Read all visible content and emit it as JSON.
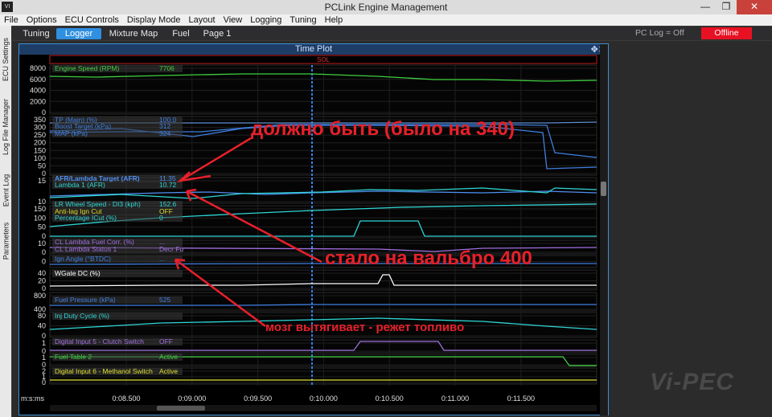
{
  "window": {
    "title": "PCLink Engine Management",
    "app_icon": "VI",
    "buttons": [
      "minimize-icon",
      "restore-icon",
      "close-icon"
    ]
  },
  "menu": [
    "File",
    "Options",
    "ECU Controls",
    "Display Mode",
    "Layout",
    "View",
    "Logging",
    "Tuning",
    "Help"
  ],
  "tabs": [
    {
      "label": "Tuning",
      "active": false
    },
    {
      "label": "Logger",
      "active": true
    },
    {
      "label": "Mixture Map",
      "active": false
    },
    {
      "label": "Fuel",
      "active": false
    },
    {
      "label": "Page 1",
      "active": false
    }
  ],
  "status": {
    "pclog": "PC Log = Off",
    "connection": "Offline"
  },
  "sidebar_tabs": [
    "ECU Settings",
    "Log File Manager",
    "Event Log",
    "Parameters"
  ],
  "plot": {
    "title": "Time Plot",
    "event_marker": "SOL",
    "time_label": "m:s:ms",
    "time_ticks": [
      "0:08.500",
      "0:09.000",
      "0:09.500",
      "0:10.000",
      "0:10.500",
      "0:11.000",
      "0:11.500"
    ],
    "channels": [
      {
        "name": "Engine Speed (RPM)",
        "value": "7706",
        "color": "#3fcf3f"
      },
      {
        "name": "TP (Main) (%)",
        "value": "100.0",
        "color": "#3f7fdf"
      },
      {
        "name": "Boost Target (kPa)",
        "value": "312",
        "color": "#3f7fdf"
      },
      {
        "name": "MAP (kPa)",
        "value": "324",
        "color": "#3f7fdf"
      },
      {
        "name": "AFR/Lambda Target (AFR)",
        "value": "11.35",
        "color": "#4f8fef"
      },
      {
        "name": "Lambda 1 (AFR)",
        "value": "10.72",
        "color": "#2fd6d6"
      },
      {
        "name": "LR Wheel Speed - DI3 (kph)",
        "value": "152.6",
        "color": "#2fd6d6"
      },
      {
        "name": "Anti-lag Ign Cut",
        "value": "OFF",
        "color": "#dfdf2f"
      },
      {
        "name": "Percentage ICut (%)",
        "value": "0",
        "color": "#2fd6d6"
      },
      {
        "name": "CL Lambda Fuel Corr. (%)",
        "value": "...",
        "color": "#a06fdf"
      },
      {
        "name": "CL Lambda Status 1",
        "value": "Decr Fu",
        "color": "#a06fdf"
      },
      {
        "name": "Ign Angle (°BTDC)",
        "value": "...",
        "color": "#3f7fdf"
      },
      {
        "name": "WGate DC (%)",
        "value": "",
        "color": "#ffffff"
      },
      {
        "name": "Fuel Pressure (kPa)",
        "value": "525",
        "color": "#3f7fdf"
      },
      {
        "name": "Inj Duty Cycle (%)",
        "value": "",
        "color": "#2fd6d6"
      },
      {
        "name": "Digital Input 5 - Clutch Switch",
        "value": "OFF",
        "color": "#a06fdf"
      },
      {
        "name": "Fuel Table 2",
        "value": "Active",
        "color": "#3fcf3f"
      },
      {
        "name": "Digital Input 6 - Methanol Switch",
        "value": "Active",
        "color": "#dfdf2f"
      }
    ],
    "axis_ticks": {
      "rpm": [
        "8000",
        "6000",
        "4000",
        "2000",
        "0"
      ],
      "boost": [
        "350",
        "300",
        "250",
        "200",
        "150",
        "100",
        "50",
        "0"
      ],
      "afr": [
        "15",
        "10"
      ],
      "speed": [
        "150",
        "100",
        "50",
        "0"
      ],
      "cl": [
        "10",
        "0"
      ],
      "ign": [
        "0"
      ],
      "wgate": [
        "40",
        "20",
        "0"
      ],
      "fuelp": [
        "800",
        "400"
      ],
      "inj": [
        "80",
        "40",
        "0"
      ],
      "dig5": [
        "1",
        "0"
      ],
      "ft2": [
        "1",
        "0"
      ],
      "dig6": [
        "2",
        "1",
        "0"
      ]
    }
  },
  "annotations": {
    "note1": "должно быть (было на 340)",
    "note2": "стало на вальбро 400",
    "note3": "мозг вытягивает - режет топливо",
    "color": "#e8202a"
  },
  "logo": "Vi-PEC"
}
